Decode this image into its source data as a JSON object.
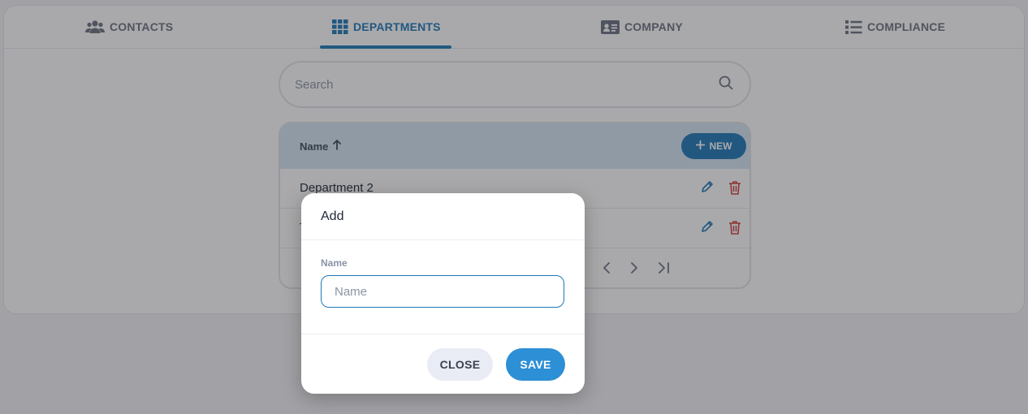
{
  "tabs": [
    {
      "label": "CONTACTS",
      "icon": "users-icon",
      "active": false
    },
    {
      "label": "DEPARTMENTS",
      "icon": "grid-icon",
      "active": true
    },
    {
      "label": "COMPANY",
      "icon": "id-card-icon",
      "active": false
    },
    {
      "label": "COMPLIANCE",
      "icon": "list-icon",
      "active": false
    }
  ],
  "search": {
    "placeholder": "Search",
    "icon": "search-icon"
  },
  "table": {
    "header": {
      "name_label": "Name",
      "sort_icon": "arrow-up-icon"
    },
    "new_label": "NEW",
    "rows": [
      {
        "name": "Department 2"
      },
      {
        "name": "T"
      }
    ]
  },
  "modal": {
    "title": "Add",
    "field_label": "Name",
    "field_placeholder": "Name",
    "close_label": "CLOSE",
    "save_label": "SAVE"
  },
  "colors": {
    "accent": "#1e78b8",
    "save": "#2d8fd5",
    "danger": "#d23c3c"
  }
}
